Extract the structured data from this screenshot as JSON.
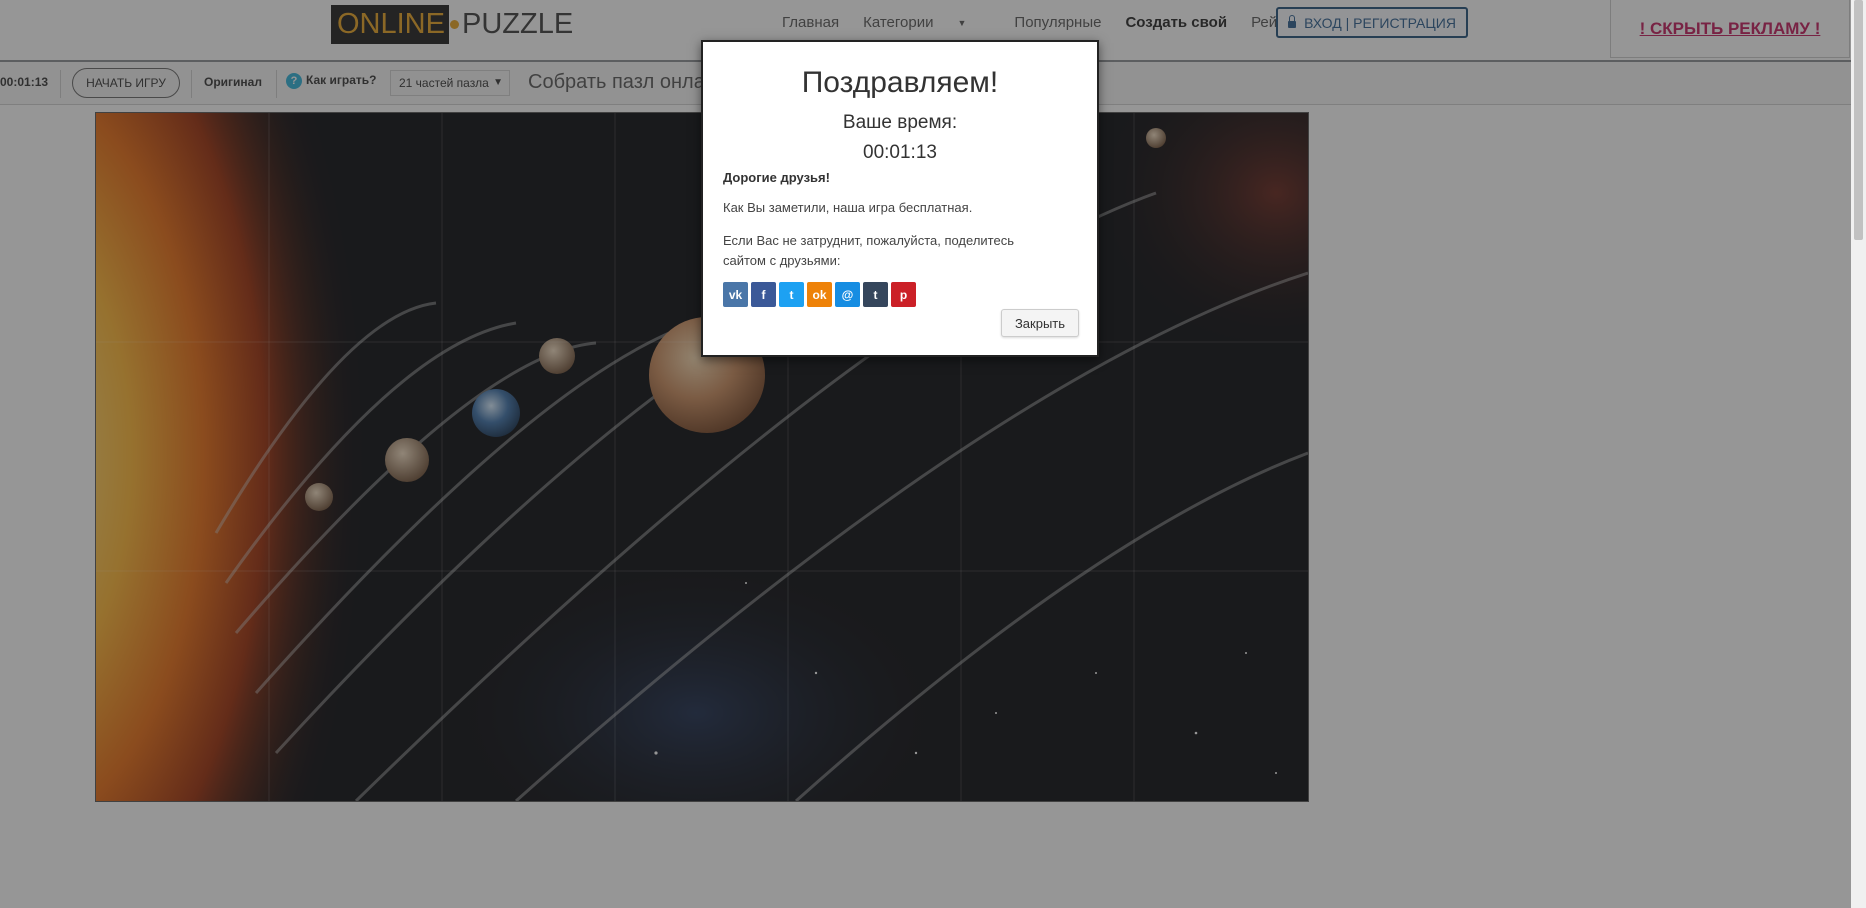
{
  "navbar": {
    "logo_online": "ONLINE",
    "logo_puzzle": "PUZZLE",
    "links": [
      "Главная",
      "Категории",
      "Популярные",
      "Создать свой",
      "Рейтинг"
    ],
    "login_label": "ВХОД | РЕГИСТРАЦИЯ",
    "ad_label": "! СКРЫТЬ РЕКЛАМУ !"
  },
  "toolbar": {
    "timer": "00:01:13",
    "start_label": "НАЧАТЬ ИГРУ",
    "original_label": "Оригинал",
    "help_label": "Как играть?",
    "pieces_selected": "21 частей пазла",
    "title": "Собрать пазл онла"
  },
  "modal": {
    "title": "Поздравляем!",
    "subtitle": "Ваше время:",
    "time": "00:01:13",
    "dear": "Дорогие друзья!",
    "para1": "Как Вы заметили, наша игра бесплатная.",
    "para2": "Если Вас не затруднит, пожалуйста, поделитесь сайтом с друзьями:",
    "socials": [
      {
        "name": "vk-icon",
        "glyph": "vk",
        "color": "#4a76a8"
      },
      {
        "name": "facebook-icon",
        "glyph": "f",
        "color": "#3b5998"
      },
      {
        "name": "twitter-icon",
        "glyph": "t",
        "color": "#1da1f2"
      },
      {
        "name": "odnoklassniki-icon",
        "glyph": "ok",
        "color": "#ee8208"
      },
      {
        "name": "moimir-icon",
        "glyph": "@",
        "color": "#168de2"
      },
      {
        "name": "tumblr-icon",
        "glyph": "t",
        "color": "#35465c"
      },
      {
        "name": "pinterest-icon",
        "glyph": "p",
        "color": "#cb2027"
      }
    ],
    "close_label": "Закрыть"
  },
  "colors": {
    "logo_accent": "#e9a21e",
    "overlay": "rgba(45,45,45,0.5)",
    "ad_link": "#c2185b",
    "login_border": "#1f4e79"
  }
}
